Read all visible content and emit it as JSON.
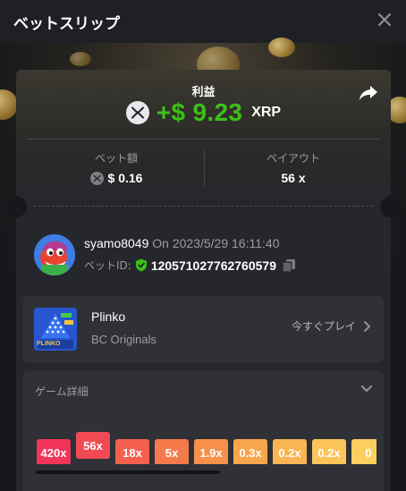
{
  "header": {
    "title": "ベットスリップ"
  },
  "result": {
    "profit_label": "利益",
    "profit_value": "+$ 9.23",
    "currency": "XRP"
  },
  "stats": {
    "bet_label": "ベット額",
    "bet_value": "$ 0.16",
    "payout_label": "ペイアウト",
    "payout_value": "56 x"
  },
  "user": {
    "name": "syamo8049",
    "timestamp": "On 2023/5/29 16:11:40",
    "bet_id_label": "ベットID:",
    "bet_id": "120571027762760579"
  },
  "game": {
    "name": "Plinko",
    "provider": "BC Originals",
    "play_label": "今すぐプレイ",
    "thumb_text": "PLINKO"
  },
  "details": {
    "title": "ゲーム詳細",
    "multipliers": [
      "420x",
      "56x",
      "18x",
      "5x",
      "1.9x",
      "0.3x",
      "0.2x",
      "0.2x",
      "0"
    ],
    "selected_index": 1
  },
  "colors": {
    "profit_green": "#3bc117",
    "verified_green": "#3bc117",
    "multiplier_gradient": [
      "#f0345a",
      "#f14a55",
      "#f3604f",
      "#f47a4b",
      "#f6904a",
      "#f8a64d",
      "#f9b553",
      "#fbc45a",
      "#fcd060"
    ]
  },
  "icons": {
    "close": "close-icon",
    "share": "share-icon",
    "xrp": "xrp-coin-icon",
    "verified": "shield-check-icon",
    "copy": "copy-icon",
    "play": "chevron-right-icon",
    "expand": "chevron-down-icon"
  }
}
